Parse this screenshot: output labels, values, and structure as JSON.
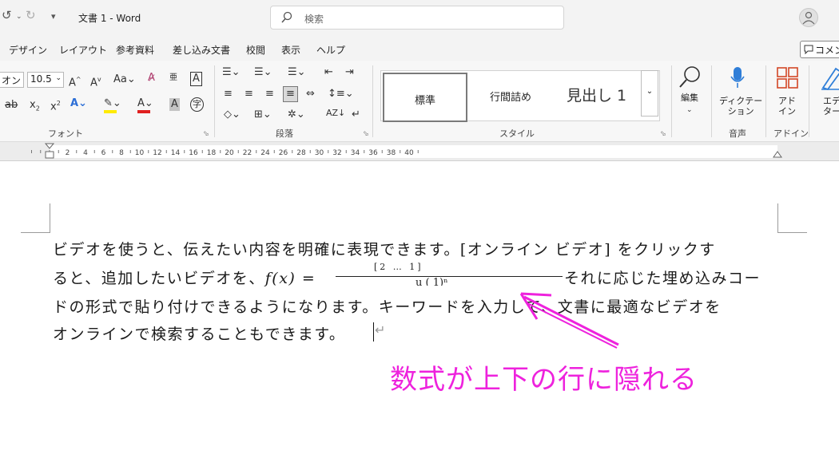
{
  "titlebar": {
    "quick_access": {
      "undo": "↺",
      "redo": "↻",
      "customize": "▾"
    },
    "doc_title": "文書 1  -  Word",
    "search_placeholder": "検索"
  },
  "tabs": [
    {
      "label": "デザイン"
    },
    {
      "label": "レイアウト"
    },
    {
      "label": "参考資料"
    },
    {
      "label": "差し込み文書"
    },
    {
      "label": "校閲"
    },
    {
      "label": "表示"
    },
    {
      "label": "ヘルプ"
    }
  ],
  "comment_button": "コメント",
  "ribbon": {
    "font": {
      "font_name": "オン",
      "font_size": "10.5",
      "label": "フォント"
    },
    "paragraph": {
      "label": "段落"
    },
    "styles": {
      "label": "スタイル",
      "items": [
        "標準",
        "行間詰め",
        "見出し 1"
      ]
    },
    "editing": {
      "label": "編集"
    },
    "voice": {
      "dictate": "ディクテー\nション",
      "group_label": "音声"
    },
    "addins": {
      "button": "アド\nイン",
      "group_label": "アドイン"
    },
    "editor": {
      "button": "エデ\nター"
    }
  },
  "ruler": {
    "ticks": [
      "2",
      "4",
      "6",
      "8",
      "10",
      "12",
      "14",
      "16",
      "18",
      "20",
      "22",
      "24",
      "26",
      "28",
      "30",
      "32",
      "34",
      "36",
      "38",
      "40"
    ]
  },
  "document": {
    "lines": [
      "ビデオを使うと、伝えたい内容を明確に表現できます。[オンライン ビデオ] をクリックす",
      "ると、追加したいビデオを、",
      "ドの形式で貼り付けできるようになります。キーワードを入力して、文書に最適なビデオを",
      "オンラインで検索することもできます。"
    ],
    "equation_lhs": "f(x) =",
    "equation_fragment_top": "[2  …  1]",
    "equation_fragment_bottom": "u   (   1)ⁿ",
    "line2_tail": "それに応じた埋め込みコー",
    "paragraph_mark": "↵"
  },
  "annotation": {
    "text": "数式が上下の行に隠れる",
    "color": "#ee22dd"
  }
}
